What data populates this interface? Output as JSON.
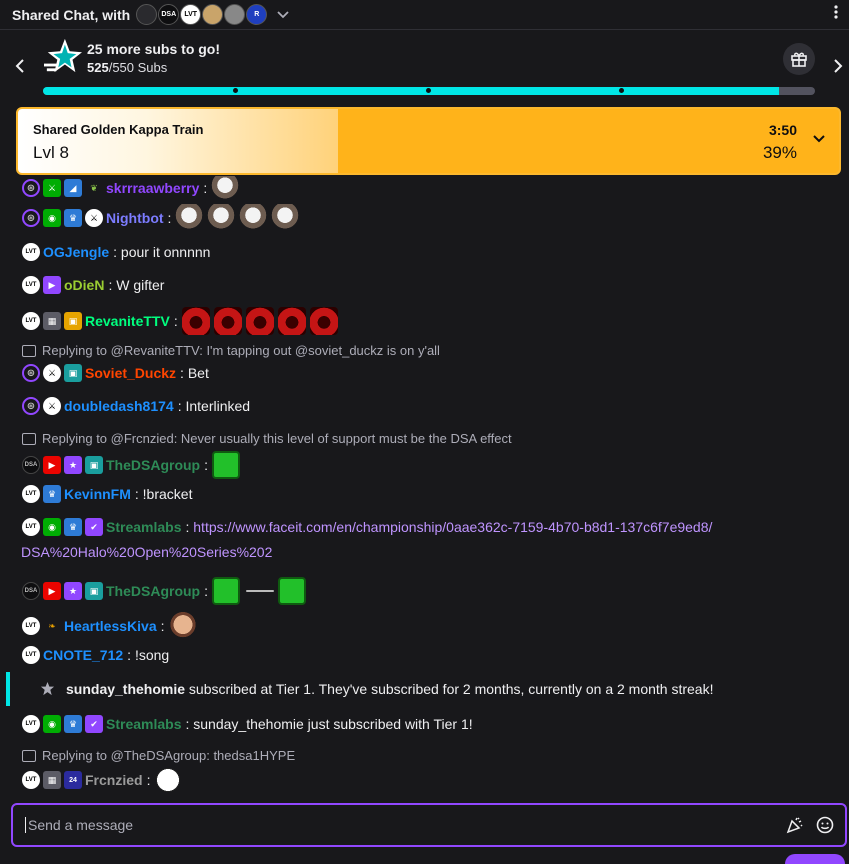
{
  "header": {
    "title": "Shared Chat, with",
    "avatars": [
      "DSA",
      "LVT",
      "R"
    ]
  },
  "goal": {
    "title": "25 more subs to go!",
    "current": "525",
    "target": "/550 Subs",
    "progress": 0.954
  },
  "train": {
    "name": "Shared Golden Kappa Train",
    "level": "Lvl 8",
    "time": "3:50",
    "percent": "39%",
    "progress": 0.39
  },
  "messages": [
    {
      "user": "skrrraawberry",
      "color": "#9147ff",
      "text": ""
    },
    {
      "user": "Nightbot",
      "color": "#7c7cff",
      "text": ""
    },
    {
      "user": "OGJengle",
      "color": "#1e90ff",
      "text": "pour it onnnnn"
    },
    {
      "user": "oDieN",
      "color": "#9acd32",
      "text": "W gifter"
    },
    {
      "user": "RevaniteTTV",
      "color": "#00ff7f",
      "text": ""
    },
    {
      "reply": "Replying to @RevaniteTTV: I'm tapping out @soviet_duckz is on y'all"
    },
    {
      "user": "Soviet_Duckz",
      "color": "#ff4500",
      "text": "Bet"
    },
    {
      "user": "doubledash8174",
      "color": "#1e90ff",
      "text": "Interlinked"
    },
    {
      "reply": "Replying to @Frcnzied: Never usually this level of support must be the DSA effect"
    },
    {
      "user": "TheDSAgroup",
      "color": "#2e8b57",
      "text": ""
    },
    {
      "user": "KevinnFM",
      "color": "#1e90ff",
      "text": "!bracket"
    },
    {
      "user": "Streamlabs",
      "color": "#2e8b57",
      "text": "",
      "link1": "https://www.faceit.com/en/championship/0aae362c-7159-4b70-b8d1-137c6f7e9ed8/",
      "link2": "DSA%20Halo%20Open%20Series%202"
    },
    {
      "user": "TheDSAgroup",
      "color": "#2e8b57",
      "text": ""
    },
    {
      "user": "HeartlessKiva",
      "color": "#1e90ff",
      "text": ""
    },
    {
      "user": "CNOTE_712",
      "color": "#1e90ff",
      "text": "!song"
    },
    {
      "user": "Streamlabs",
      "color": "#2e8b57",
      "text": "sunday_thehomie just subscribed with Tier 1!"
    },
    {
      "reply": "Replying to @TheDSAgroup: thedsa1HYPE"
    },
    {
      "user": "Frcnzied",
      "color": "#9b9b9b",
      "text": ""
    }
  ],
  "sub_notice": {
    "user": "sunday_thehomie",
    "text": "subscribed at Tier 1. They've subscribed for 2 months, currently on a 2 month streak!"
  },
  "input": {
    "placeholder": "Send a message"
  },
  "colors": {
    "accent": "#9147ff",
    "goal": "#00e6e6",
    "train": "#ffb31a"
  }
}
